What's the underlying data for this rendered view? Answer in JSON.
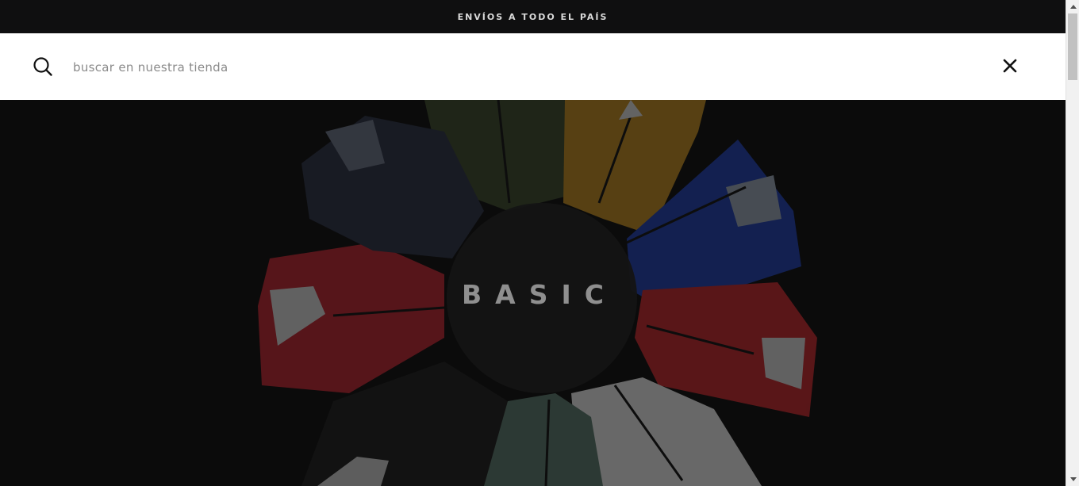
{
  "announcement": {
    "text": "ENVÍOS A TODO EL PAÍS"
  },
  "search": {
    "placeholder": "buscar en nuestra tienda",
    "value": "",
    "search_icon": "search-icon",
    "close_icon": "close-icon"
  },
  "hero": {
    "title": "BASIC",
    "image": "jerseys-arranged-in-circle",
    "jersey_colors": [
      "#3c4a2a",
      "#c08a1e",
      "#1f3fb0",
      "#c4262c",
      "#e9e9e9",
      "#5b7a6e",
      "#1c1c1c",
      "#bd2430",
      "#2a3145"
    ]
  },
  "scrollbar": {
    "up_icon": "scroll-up-arrow-icon",
    "down_icon": "scroll-down-arrow-icon"
  }
}
